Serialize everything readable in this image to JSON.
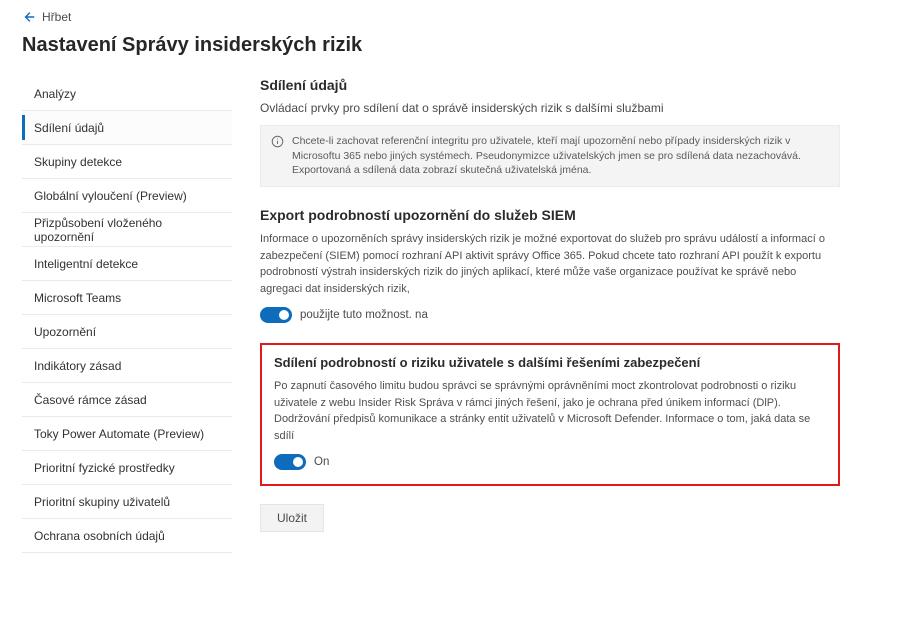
{
  "back": {
    "label": "Hřbet"
  },
  "page": {
    "title": "Nastavení Správy insiderských rizik"
  },
  "sidebar": {
    "items": [
      {
        "label": "Analýzy",
        "active": false
      },
      {
        "label": "Sdílení údajů",
        "active": true
      },
      {
        "label": "Skupiny detekce",
        "active": false
      },
      {
        "label": "Globální vyloučení (Preview)",
        "active": false
      },
      {
        "label": "Přizpůsobení vloženého upozornění",
        "active": false
      },
      {
        "label": "Inteligentní detekce",
        "active": false
      },
      {
        "label": "Microsoft Teams",
        "active": false
      },
      {
        "label": "Upozornění",
        "active": false
      },
      {
        "label": "Indikátory zásad",
        "active": false
      },
      {
        "label": "Časové rámce zásad",
        "active": false
      },
      {
        "label": "Toky Power Automate (Preview)",
        "active": false
      },
      {
        "label": "Prioritní fyzické prostředky",
        "active": false
      },
      {
        "label": "Prioritní skupiny uživatelů",
        "active": false
      },
      {
        "label": "Ochrana osobních údajů",
        "active": false
      }
    ]
  },
  "main": {
    "section1": {
      "heading": "Sdílení údajů",
      "sub": "Ovládací prvky pro sdílení dat o správě insiderských rizik s dalšími službami",
      "info": "Chcete-li zachovat referenční integritu pro uživatele, kteří mají upozornění nebo případy insiderských rizik v Microsoftu 365 nebo jiných systémech. Pseudonymizce uživatelských jmen se pro sdílená data nezachovává. Exportovaná a sdílená data zobrazí skutečná uživatelská jména."
    },
    "section2": {
      "heading": "Export podrobností upozornění do služeb SIEM",
      "body": "Informace o upozorněních správy insiderských rizik je možné exportovat do služeb pro správu událostí a informací o zabezpečení (SIEM) pomocí rozhraní API aktivit správy Office 365. Pokud chcete tato rozhraní API použít k exportu podrobností výstrah insiderských rizik do jiných aplikací, které může vaše organizace používat ke správě nebo agregaci dat insiderských rizik,",
      "toggle_label": "použijte tuto možnost. na"
    },
    "section3": {
      "heading": "Sdílení podrobností o riziku uživatele s dalšími řešeními zabezpečení",
      "body": "Po zapnutí časového limitu budou správci se správnými oprávněními moct zkontrolovat podrobnosti o riziku uživatele z webu Insider Risk Správa v rámci jiných řešení, jako je ochrana před únikem informací (DlP). Dodržování předpisů komunikace a stránky entit uživatelů v Microsoft Defender. Informace o tom, jaká data se sdílí",
      "toggle_label": "On"
    },
    "save_label": "Uložit"
  }
}
